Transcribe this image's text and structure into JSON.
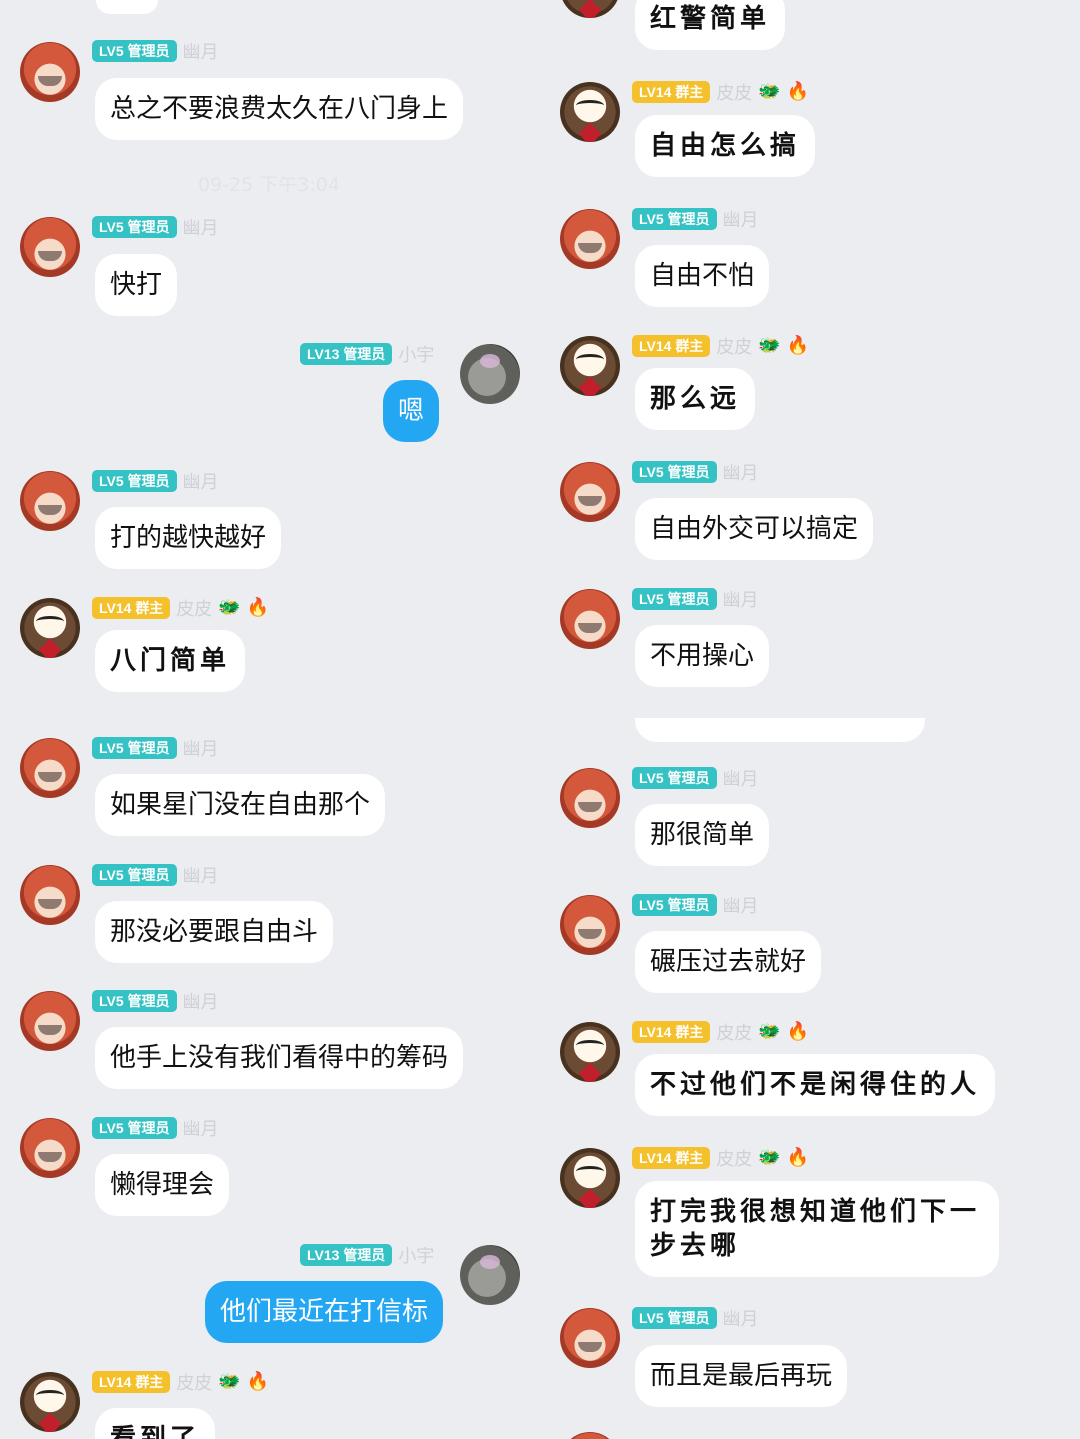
{
  "left": {
    "timestamp": "09-25 下午3:04",
    "messages": [
      {
        "badge": "LV5 管理员",
        "sender": "幽月",
        "text": "总之不要浪费太久在八门身上"
      },
      {
        "badge": "LV5 管理员",
        "sender": "幽月",
        "text": "快打"
      },
      {
        "badge": "LV13 管理员",
        "sender": "小宇",
        "text": "嗯"
      },
      {
        "badge": "LV5 管理员",
        "sender": "幽月",
        "text": "打的越快越好"
      },
      {
        "badge": "LV14 群主",
        "sender": "皮皮",
        "text": "八门简单"
      },
      {
        "badge": "LV5 管理员",
        "sender": "幽月",
        "text": "如果星门没在自由那个"
      },
      {
        "badge": "LV5 管理员",
        "sender": "幽月",
        "text": "那没必要跟自由斗"
      },
      {
        "badge": "LV5 管理员",
        "sender": "幽月",
        "text": "他手上没有我们看得中的筹码"
      },
      {
        "badge": "LV5 管理员",
        "sender": "幽月",
        "text": "懒得理会"
      },
      {
        "badge": "LV13 管理员",
        "sender": "小宇",
        "text": "他们最近在打信标"
      },
      {
        "badge": "LV14 群主",
        "sender": "皮皮",
        "text": "看到了"
      }
    ]
  },
  "right": {
    "messages": [
      {
        "text": "红警简单"
      },
      {
        "badge": "LV14 群主",
        "sender": "皮皮",
        "text": "自由怎么搞"
      },
      {
        "badge": "LV5 管理员",
        "sender": "幽月",
        "text": "自由不怕"
      },
      {
        "badge": "LV14 群主",
        "sender": "皮皮",
        "text": "那么远"
      },
      {
        "badge": "LV5 管理员",
        "sender": "幽月",
        "text": "自由外交可以搞定"
      },
      {
        "badge": "LV5 管理员",
        "sender": "幽月",
        "text": "不用操心"
      },
      {
        "badge": "LV5 管理员",
        "sender": "幽月",
        "text": "那很简单"
      },
      {
        "badge": "LV5 管理员",
        "sender": "幽月",
        "text": "碾压过去就好"
      },
      {
        "badge": "LV14 群主",
        "sender": "皮皮",
        "text": "不过他们不是闲得住的人"
      },
      {
        "badge": "LV14 群主",
        "sender": "皮皮",
        "text": "打完我很想知道他们下一步去哪"
      },
      {
        "badge": "LV5 管理员",
        "sender": "幽月",
        "text": "而且是最后再玩"
      }
    ]
  }
}
